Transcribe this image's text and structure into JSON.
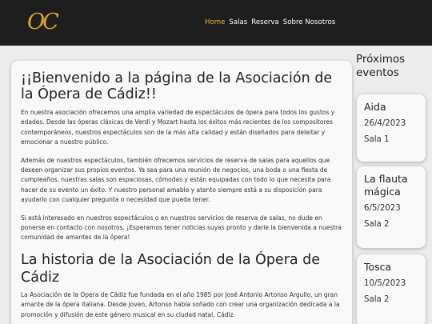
{
  "header": {
    "logo_text": "OC",
    "nav": [
      {
        "label": "Home"
      },
      {
        "label": "Salas"
      },
      {
        "label": "Reserva"
      },
      {
        "label": "Sobre Nosotros"
      }
    ]
  },
  "main": {
    "welcome_title": "¡¡Bienvenido a la página de la Asociación de la Ópera de Cádiz!!",
    "paragraphs": [
      "En nuestra asociación ofrecemos una amplia variedad de espectáculos de ópera para todos los gustos y edades. Desde las óperas clásicas de Verdi y Mozart hasta los éxitos más recientes de los compositores contemporáneos, nuestros espectáculos son de la más alta calidad y están diseñados para deleitar y emocionar a nuestro público.",
      "Además de nuestros espectáculos, también ofrecemos servicios de reserva de salas para aquellos que deseen organizar sus propios eventos. Ya sea para una reunión de negocios, una boda o una fiesta de cumpleaños, nuestras salas son espaciosas, cómodas y están equipadas con todo lo que necesita para hacer de su evento un éxito. Y nuestro personal amable y atento siempre está a su disposición para ayudarlo con cualquier pregunta o necesidad que pueda tener.",
      "Si está interesado en nuestros espectáculos o en nuestros servicios de reserva de salas, no dude en ponerse en contacto con nosotros. ¡Esperamos tener noticias suyas pronto y darle la bienvenida a nuestra comunidad de amantes de la ópera!"
    ],
    "history_title": "La historia de la Asociación de la Ópera de Cádiz",
    "history_paragraph": "La Asociación de la Ópera de Cádiz fue fundada en el año 1985 por José Antonio Artonso Argullo, un gran amante de la ópera italiana. Desde joven, Artonso había soñado con crear una organización dedicada a la promoción y difusión de este género musical en su ciudad natal, Cádiz."
  },
  "sidebar": {
    "title": "Próximos eventos",
    "events": [
      {
        "name": "Aida",
        "date": "26/4/2023",
        "room": "Sala 1"
      },
      {
        "name": "La flauta mágica",
        "date": "6/5/2023",
        "room": "Sala 2"
      },
      {
        "name": "Tosca",
        "date": "10/5/2023",
        "room": "Sala 2"
      }
    ]
  },
  "colors": {
    "header_bg": "#1e1e1e",
    "accent": "#f0b02c",
    "logo": "#d9a52e",
    "page_bg": "#ececec",
    "card_bg": "#f8f8f8"
  }
}
